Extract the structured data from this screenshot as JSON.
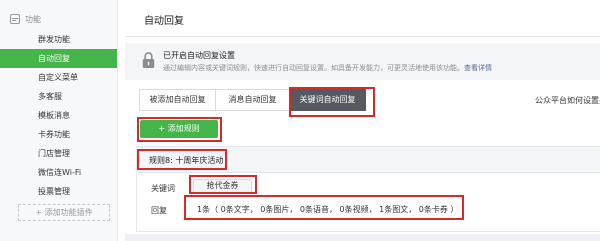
{
  "sidebar": {
    "section_label": "功能",
    "items": [
      {
        "label": "群发功能",
        "active": false
      },
      {
        "label": "自动回复",
        "active": true
      },
      {
        "label": "自定义菜单",
        "active": false
      },
      {
        "label": "多客服",
        "active": false
      },
      {
        "label": "模板消息",
        "active": false
      },
      {
        "label": "卡券功能",
        "active": false
      },
      {
        "label": "门店管理",
        "active": false
      },
      {
        "label": "微信连Wi-Fi",
        "active": false
      },
      {
        "label": "投票管理",
        "active": false
      }
    ],
    "add_plugin_label": "+ 添加功能插件"
  },
  "main": {
    "title": "自动回复",
    "notice": {
      "title": "已开启自动回复设置",
      "description": "通过编辑内容或关键词规则，快速进行自动回复设置。如具备开发能力，可更灵活地使用该功能。",
      "link": "查看详情"
    },
    "tabs": [
      {
        "label": "被添加自动回复",
        "active": false
      },
      {
        "label": "消息自动回复",
        "active": false
      },
      {
        "label": "关键词自动回复",
        "active": true
      }
    ],
    "right_note": "公众平台如何设置关",
    "add_rule_button": "+ 添加规则",
    "rule": {
      "name": "规则8: 十周年庆活动",
      "keyword_label": "关键词",
      "keyword": "抢代金券",
      "reply_label": "回复",
      "reply_summary": "1条（ 0条文字， 0条图片， 0条语音， 0条视频， 1条图文， 0条卡券 ）"
    }
  },
  "colors": {
    "accent_green": "#44b549",
    "active_tab": "#565a60",
    "highlight_red": "#d42a2a",
    "link": "#576b95"
  },
  "icons": [
    "menu-icon",
    "lock-icon"
  ]
}
